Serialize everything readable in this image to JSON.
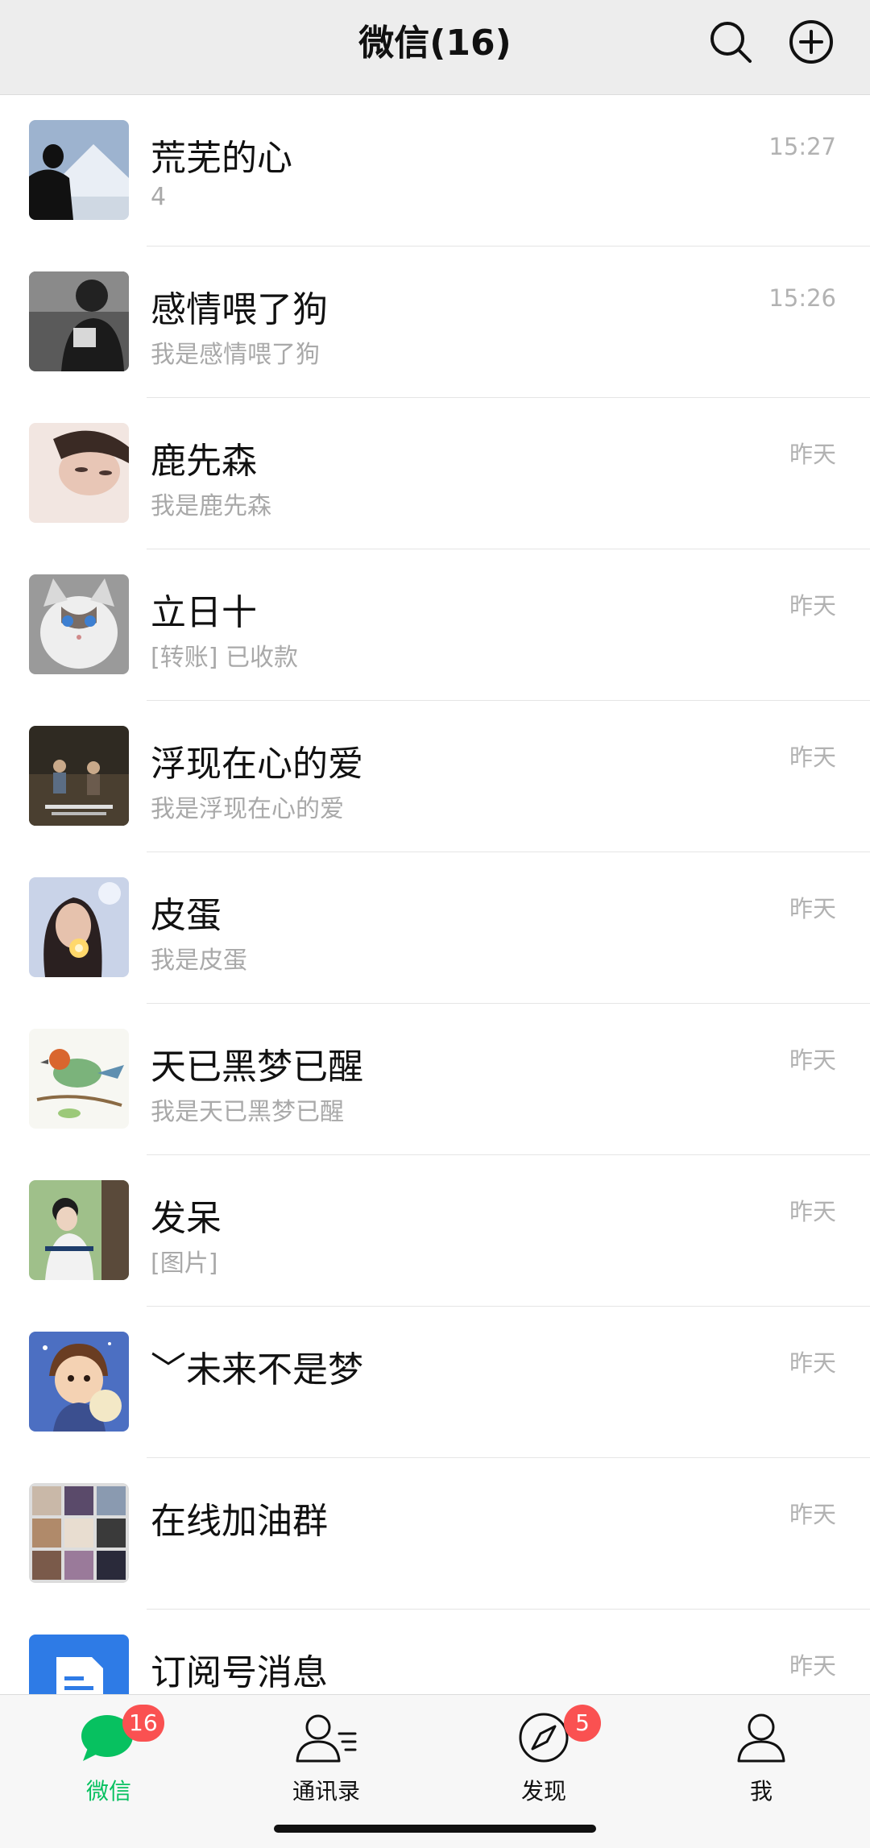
{
  "header": {
    "title": "微信(16)"
  },
  "chats": [
    {
      "name": "荒芜的心",
      "message": "4",
      "time": "15:27"
    },
    {
      "name": "感情喂了狗",
      "message": "我是感情喂了狗",
      "time": "15:26"
    },
    {
      "name": "鹿先森",
      "message": "我是鹿先森",
      "time": "昨天"
    },
    {
      "name": "立日十",
      "message": "[转账] 已收款",
      "time": "昨天"
    },
    {
      "name": "浮现在心的爱",
      "message": "我是浮现在心的爱",
      "time": "昨天"
    },
    {
      "name": "皮蛋",
      "message": "我是皮蛋",
      "time": "昨天"
    },
    {
      "name": "天已黑梦已醒",
      "message": "我是天已黑梦已醒",
      "time": "昨天"
    },
    {
      "name": "发呆",
      "message": "[图片]",
      "time": "昨天"
    },
    {
      "name": "﹀未来不是梦",
      "message": "",
      "time": "昨天"
    },
    {
      "name": "在线加油群",
      "message": "",
      "time": "昨天"
    },
    {
      "name": "订阅号消息",
      "message": "",
      "time": "昨天"
    }
  ],
  "tabbar": {
    "tabs": [
      {
        "label": "微信",
        "badge": "16",
        "active": true
      },
      {
        "label": "通讯录",
        "badge": "",
        "active": false
      },
      {
        "label": "发现",
        "badge": "5",
        "active": false
      },
      {
        "label": "我",
        "badge": "",
        "active": false
      }
    ]
  },
  "colors": {
    "accent": "#07c160",
    "badge": "#fa5151",
    "header_bg": "#ededed"
  }
}
